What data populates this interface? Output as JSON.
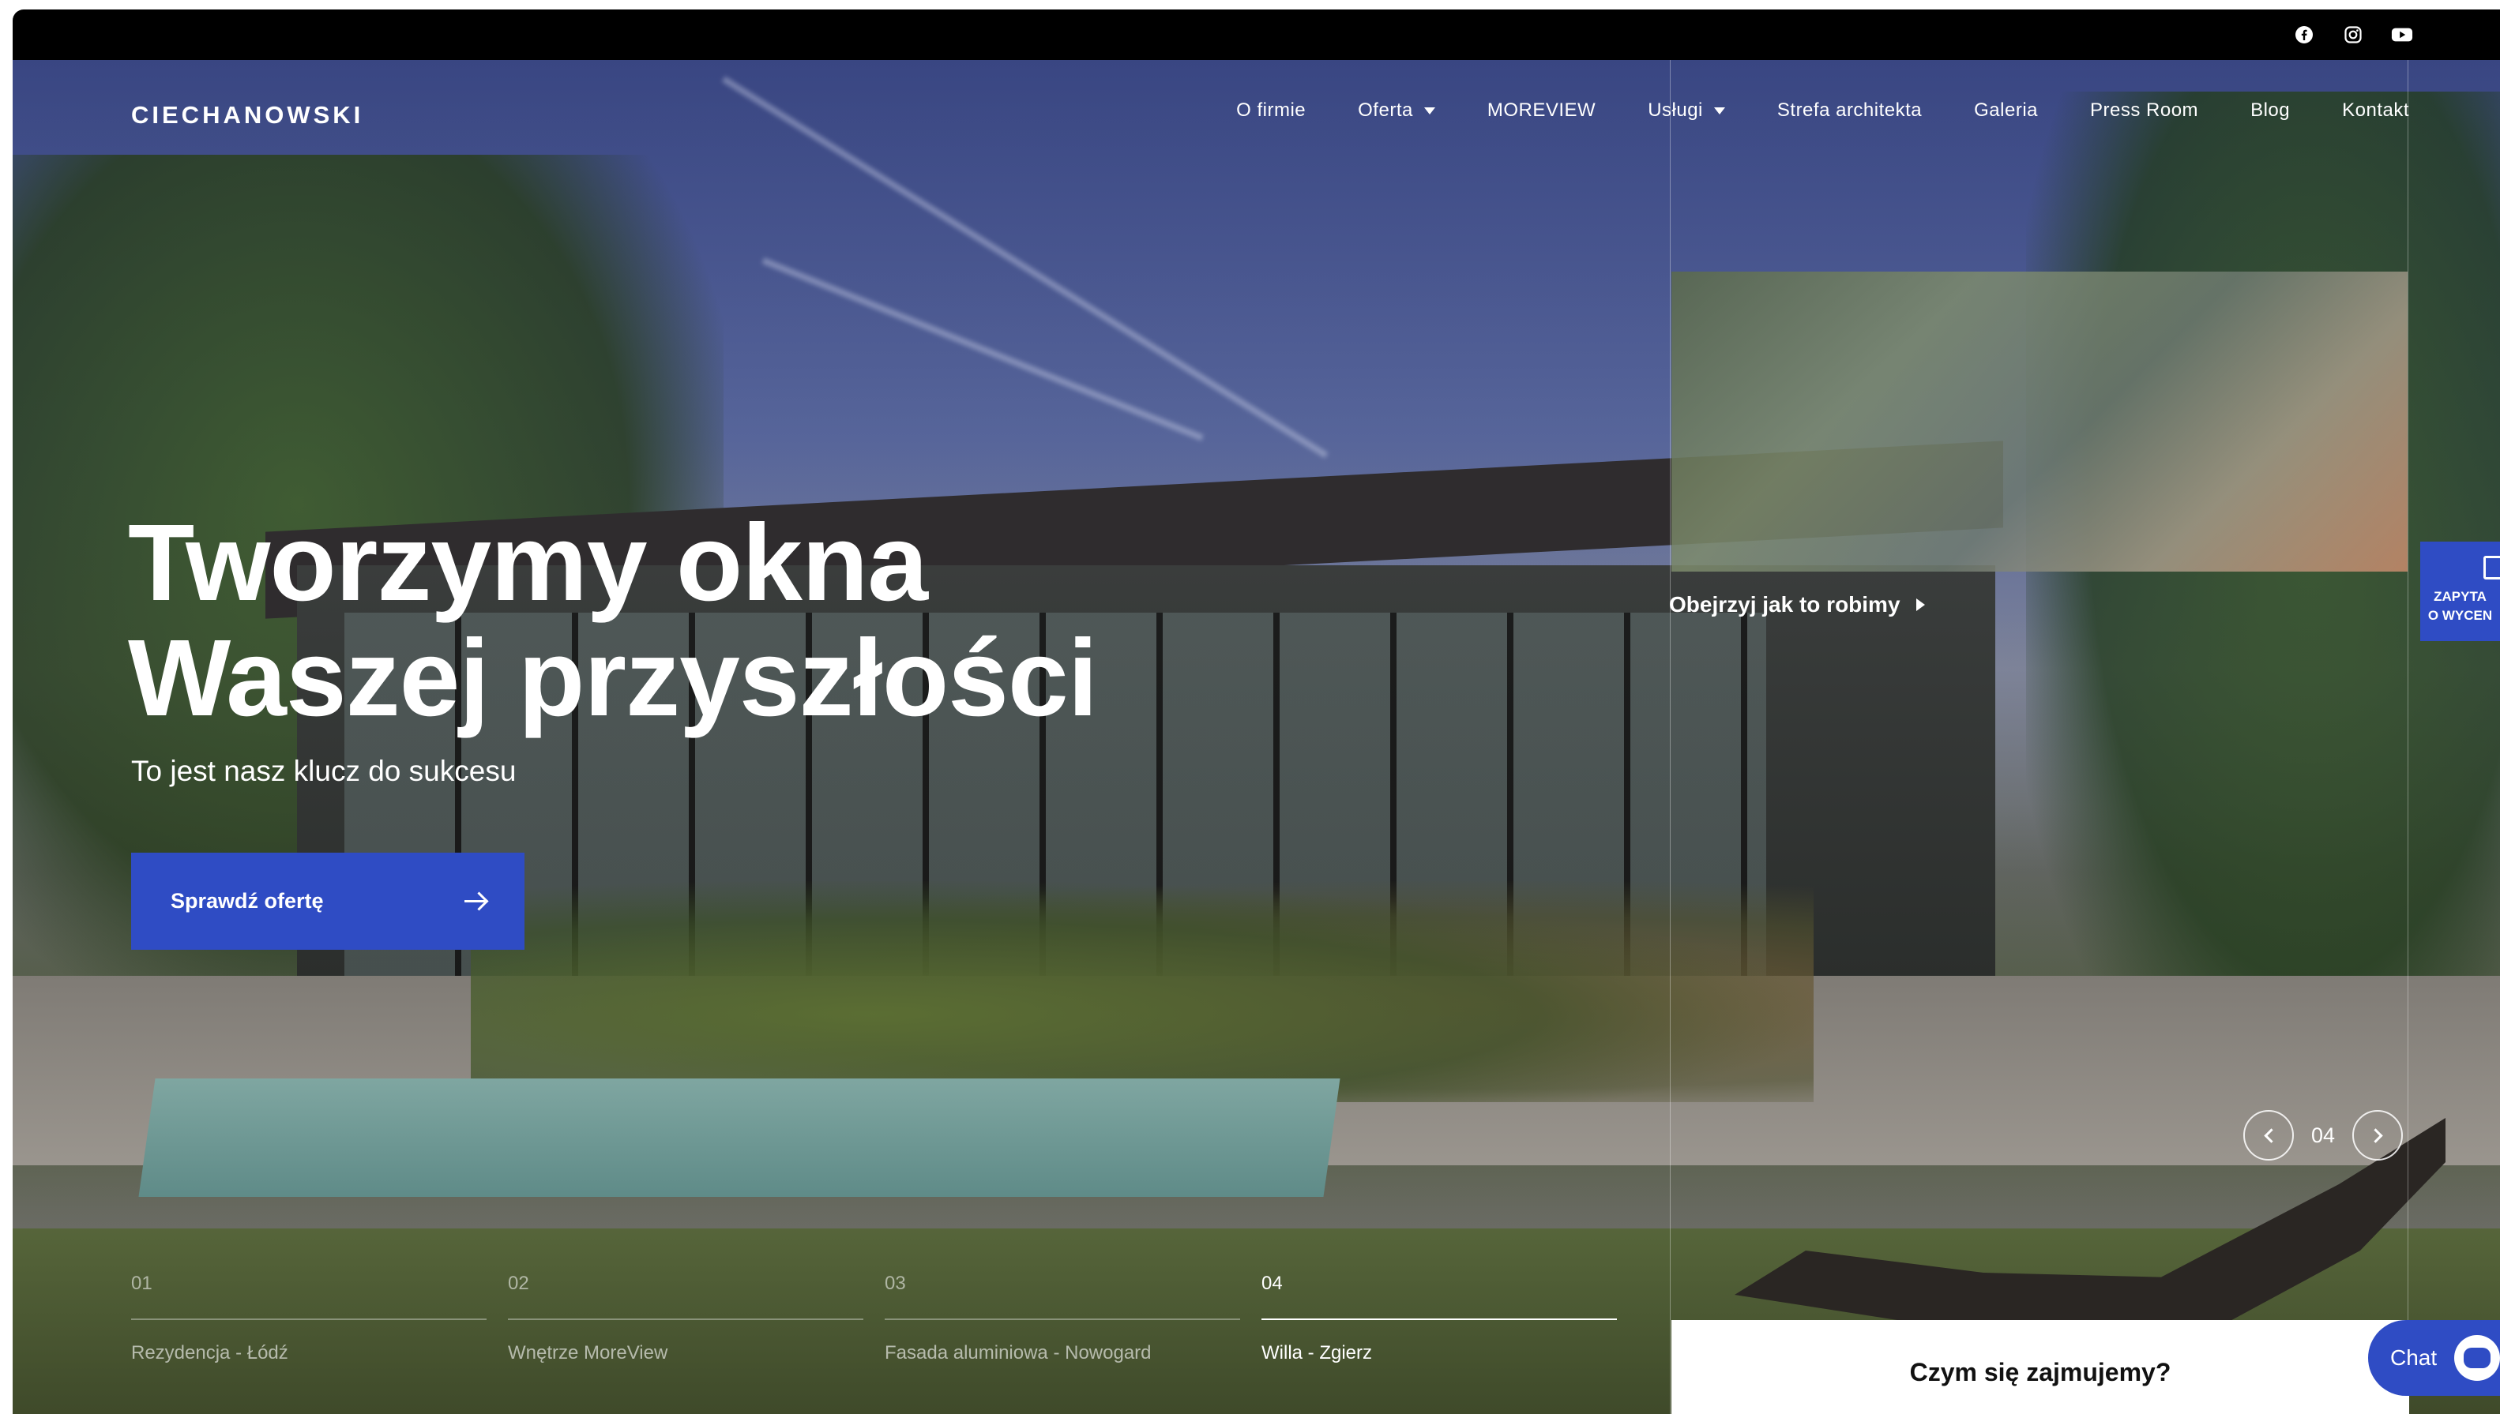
{
  "brand": {
    "logo_text": "CIECHANOWSKI",
    "accent_color": "#2f4cc4"
  },
  "topbar": {
    "socials": [
      {
        "icon": "facebook-icon"
      },
      {
        "icon": "instagram-icon"
      },
      {
        "icon": "youtube-icon"
      }
    ]
  },
  "nav": {
    "items": [
      {
        "label": "O firmie",
        "dropdown": false
      },
      {
        "label": "Oferta",
        "dropdown": true
      },
      {
        "label": "MOREVIEW",
        "dropdown": false
      },
      {
        "label": "Usługi",
        "dropdown": true
      },
      {
        "label": "Strefa architekta",
        "dropdown": false
      },
      {
        "label": "Galeria",
        "dropdown": false
      },
      {
        "label": "Press Room",
        "dropdown": false
      },
      {
        "label": "Blog",
        "dropdown": false
      },
      {
        "label": "Kontakt",
        "dropdown": false
      }
    ]
  },
  "hero": {
    "title_line1": "Tworzymy okna",
    "title_line2": "Waszej przyszłości",
    "subtitle": "To jest nasz klucz do sukcesu",
    "cta_label": "Sprawdź ofertę",
    "video_link": "Obejrzyj jak to robimy"
  },
  "side_tab": {
    "line1": "ZAPYTA",
    "line2": "O WYCEN"
  },
  "slider": {
    "current": "04",
    "items": [
      {
        "num": "01",
        "name": "Rezydencja - Łódź",
        "active": false
      },
      {
        "num": "02",
        "name": "Wnętrze MoreView",
        "active": false
      },
      {
        "num": "03",
        "name": "Fasada aluminiowa - Nowogard",
        "active": false
      },
      {
        "num": "04",
        "name": "Willa - Zgierz",
        "active": true
      }
    ]
  },
  "section_teaser": {
    "title": "Czym się zajmujemy?"
  },
  "chat": {
    "label": "Chat"
  }
}
